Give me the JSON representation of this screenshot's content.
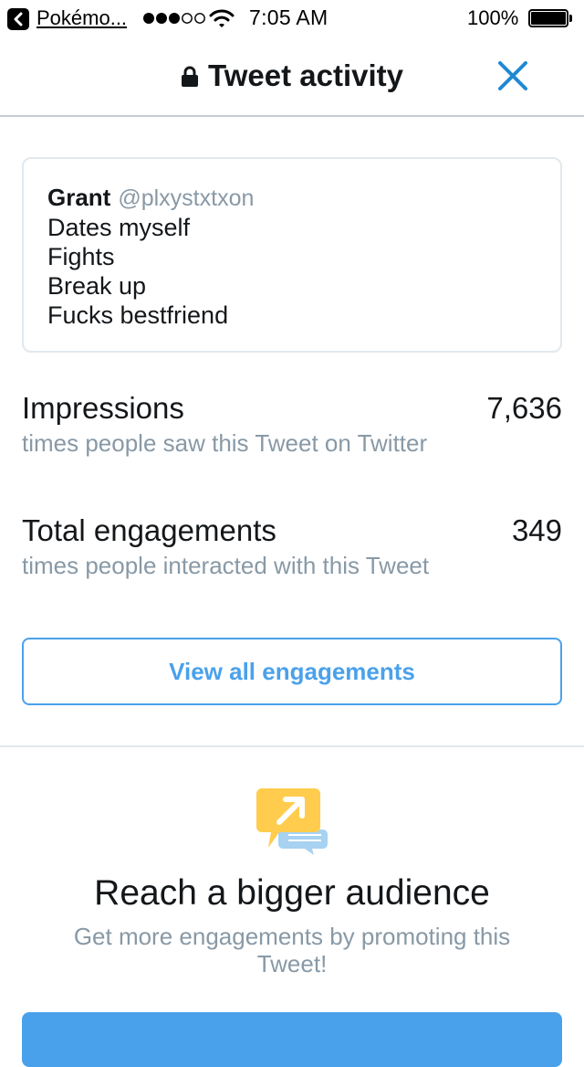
{
  "status_bar": {
    "back_app": "Pokémo...",
    "time": "7:05 AM",
    "battery_percent": "100%",
    "signal_bars_filled": 3,
    "signal_bars_total": 5
  },
  "nav": {
    "title": "Tweet activity",
    "lock_icon": "lock-icon",
    "close_icon": "close-icon"
  },
  "tweet": {
    "name": "Grant",
    "handle": "@plxystxtxon",
    "lines": [
      "Dates myself",
      "Fights",
      "Break up",
      "Fucks bestfriend"
    ]
  },
  "metrics": {
    "impressions": {
      "label": "Impressions",
      "value": "7,636",
      "description": "times people saw this Tweet on Twitter"
    },
    "engagements": {
      "label": "Total engagements",
      "value": "349",
      "description": "times people interacted with this Tweet"
    }
  },
  "view_all_label": "View all engagements",
  "promo": {
    "icon": "promote-speech-bubbles-icon",
    "title": "Reach a bigger audience",
    "subtitle": "Get more engagements by promoting this Tweet!"
  },
  "colors": {
    "accent": "#4aa1eb",
    "text": "#14171a",
    "muted": "#8899a6",
    "border": "#e1e8ed"
  }
}
